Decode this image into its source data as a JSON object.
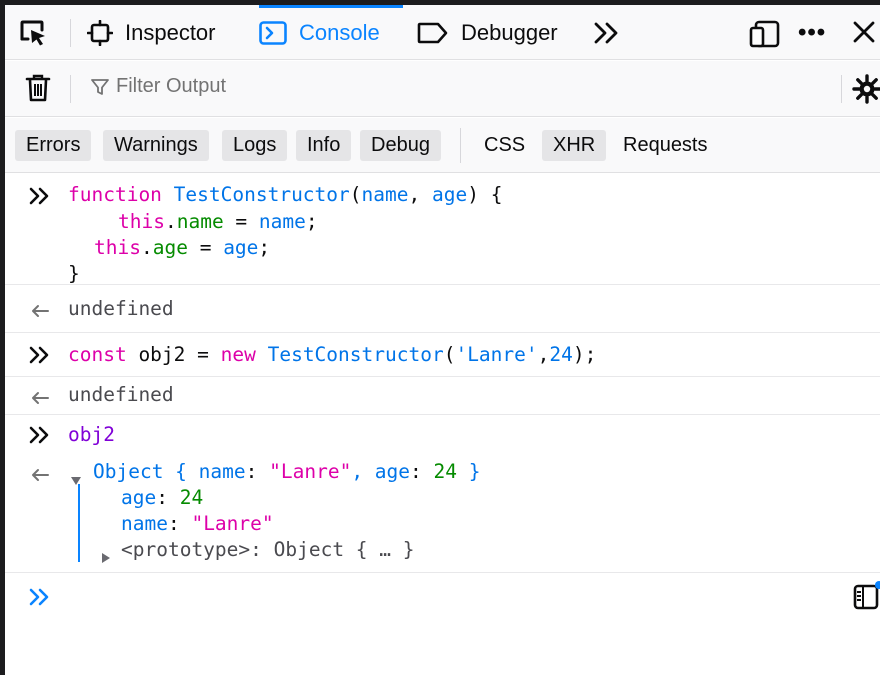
{
  "toolbar": {
    "tabs": [
      {
        "label": "Inspector",
        "selected": false
      },
      {
        "label": "Console",
        "selected": true
      },
      {
        "label": "Debugger",
        "selected": false
      }
    ]
  },
  "filter": {
    "placeholder": "Filter Output"
  },
  "categories": [
    {
      "label": "Errors",
      "active": true
    },
    {
      "label": "Warnings",
      "active": true
    },
    {
      "label": "Logs",
      "active": true
    },
    {
      "label": "Info",
      "active": true
    },
    {
      "label": "Debug",
      "active": true
    },
    {
      "label": "CSS",
      "active": false
    },
    {
      "label": "XHR",
      "active": true
    },
    {
      "label": "Requests",
      "active": false
    }
  ],
  "console": {
    "entry1": {
      "kw_function": "function",
      "fn_name": "TestConstructor",
      "open_paren": "(",
      "param1": "name",
      "comma": ", ",
      "param2": "age",
      "close": ") {",
      "kw_this1": "this",
      "dot1": ".",
      "prop1": "name",
      "eq1": " = ",
      "val1": "name",
      "semi1": ";",
      "kw_this2": "this",
      "dot2": ".",
      "prop2": "age",
      "eq2": " = ",
      "val2": "age",
      "semi2": ";",
      "close_brace": "}",
      "result": "undefined"
    },
    "entry2": {
      "kw_const": "const",
      "var_name": " obj2 = ",
      "kw_new": "new",
      "ctor": " TestConstructor",
      "open": "(",
      "arg1": "'Lanre'",
      "comma": ",",
      "arg2": "24",
      "close": ");",
      "result": "undefined"
    },
    "entry3": {
      "input": "obj2",
      "summary_prefix": "Object { ",
      "summary_key1": "name",
      "summary_colon1": ": ",
      "summary_val1": "\"Lanre\"",
      "summary_sep": ", ",
      "summary_key2": "age",
      "summary_colon2": ": ",
      "summary_val2": "24",
      "summary_suffix": " }",
      "prop_age_key": "age",
      "prop_age_colon": ": ",
      "prop_age_val": "24",
      "prop_name_key": "name",
      "prop_name_colon": ": ",
      "prop_name_val": "\"Lanre\"",
      "proto_label": "<prototype>: Object { … }"
    }
  }
}
